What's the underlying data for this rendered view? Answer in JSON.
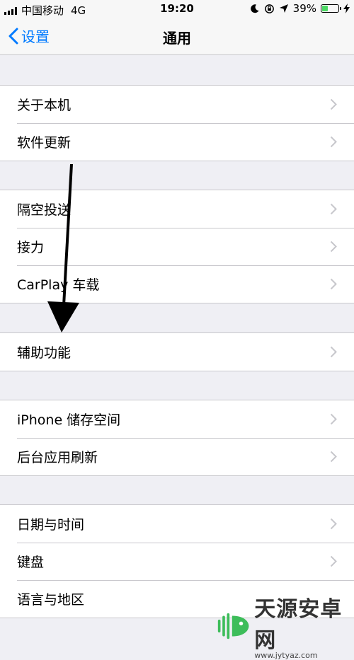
{
  "status": {
    "carrier": "中国移动",
    "network": "4G",
    "time": "19:20",
    "battery_percent_label": "39%",
    "battery_level": 0.39
  },
  "nav": {
    "back_label": "设置",
    "title": "通用"
  },
  "groups": [
    {
      "items": [
        {
          "label": "关于本机"
        },
        {
          "label": "软件更新"
        }
      ]
    },
    {
      "items": [
        {
          "label": "隔空投送"
        },
        {
          "label": "接力"
        },
        {
          "label": "CarPlay 车载"
        }
      ]
    },
    {
      "items": [
        {
          "label": "辅助功能"
        }
      ]
    },
    {
      "items": [
        {
          "label": "iPhone 储存空间"
        },
        {
          "label": "后台应用刷新"
        }
      ]
    },
    {
      "items": [
        {
          "label": "日期与时间"
        },
        {
          "label": "键盘"
        },
        {
          "label": "语言与地区"
        }
      ]
    }
  ],
  "watermark": {
    "title": "天源安卓网",
    "url": "www.jytyaz.com"
  },
  "colors": {
    "accent": "#007aff",
    "battery": "#4cd964",
    "background": "#efeff4",
    "separator": "#c8c7cc",
    "chevron": "#c7c7cc"
  }
}
